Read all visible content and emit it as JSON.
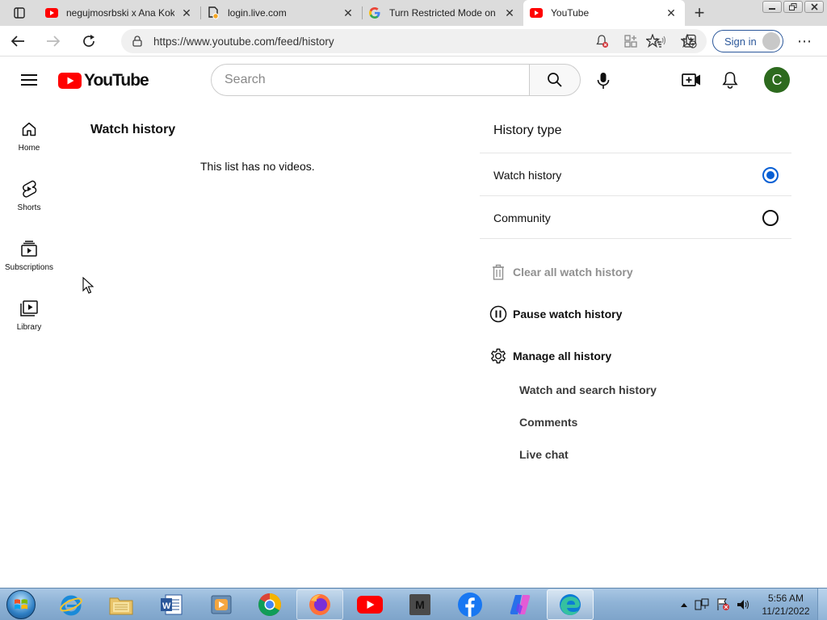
{
  "browser": {
    "tabs": [
      {
        "title": "negujmosrbski x Ana Koki",
        "icon": "youtube-icon",
        "active": false
      },
      {
        "title": "login.live.com",
        "icon": "page-loading-icon",
        "active": false
      },
      {
        "title": "Turn Restricted Mode on",
        "icon": "google-icon",
        "active": false
      },
      {
        "title": "YouTube",
        "icon": "youtube-icon",
        "active": true
      }
    ],
    "close_glyph": "✕",
    "new_tab_glyph": "+",
    "url": "https://www.youtube.com/feed/history",
    "signin_label": "Sign in",
    "more_glyph": "⋯"
  },
  "youtube": {
    "logo_text": "YouTube",
    "search_placeholder": "Search",
    "account_initial": "C",
    "brand_red": "#ff0000",
    "accent_blue": "#065fd4",
    "avatar_color": "#2d6a1e"
  },
  "guide": [
    {
      "label": "Home",
      "icon": "home-icon"
    },
    {
      "label": "Shorts",
      "icon": "shorts-icon"
    },
    {
      "label": "Subscriptions",
      "icon": "subscriptions-icon"
    },
    {
      "label": "Library",
      "icon": "library-icon"
    }
  ],
  "main": {
    "title": "Watch history",
    "empty_message": "This list has no videos."
  },
  "history_panel": {
    "title": "History type",
    "options": [
      {
        "label": "Watch history",
        "selected": true
      },
      {
        "label": "Community",
        "selected": false
      }
    ],
    "actions": {
      "clear": "Clear all watch history",
      "pause": "Pause watch history",
      "manage": "Manage all history"
    },
    "sub_links": [
      "Watch and search history",
      "Comments",
      "Live chat"
    ]
  },
  "taskbar": {
    "apps": [
      "Internet Explorer",
      "Windows Explorer",
      "Microsoft Word",
      "Media Player",
      "Google Chrome",
      "Firefox",
      "YouTube",
      "M",
      "Facebook",
      "Copilot",
      "Microsoft Edge"
    ],
    "app_m_letter": "M",
    "time": "5:56 AM",
    "date": "11/21/2022"
  }
}
